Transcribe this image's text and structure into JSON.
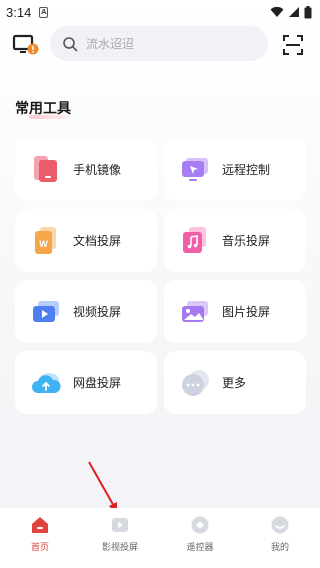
{
  "status_bar": {
    "time": "3:14",
    "notif_badge": "A"
  },
  "search": {
    "placeholder": "流水迢迢"
  },
  "section": {
    "title": "常用工具"
  },
  "tools": [
    {
      "label": "手机镜像",
      "icon": "phone-mirror-icon"
    },
    {
      "label": "远程控制",
      "icon": "remote-control-icon"
    },
    {
      "label": "文档投屏",
      "icon": "document-cast-icon"
    },
    {
      "label": "音乐投屏",
      "icon": "music-cast-icon"
    },
    {
      "label": "视频投屏",
      "icon": "video-cast-icon"
    },
    {
      "label": "图片投屏",
      "icon": "image-cast-icon"
    },
    {
      "label": "网盘投屏",
      "icon": "cloud-cast-icon"
    },
    {
      "label": "更多",
      "icon": "more-icon"
    }
  ],
  "nav": [
    {
      "label": "首页",
      "icon": "home-icon",
      "active": true
    },
    {
      "label": "影视投屏",
      "icon": "video-play-icon",
      "active": false
    },
    {
      "label": "遥控器",
      "icon": "remote-icon",
      "active": false
    },
    {
      "label": "我的",
      "icon": "profile-icon",
      "active": false
    }
  ],
  "colors": {
    "accent": "#e2433f",
    "background": "#f2f3f7",
    "tile": "#ffffff"
  }
}
